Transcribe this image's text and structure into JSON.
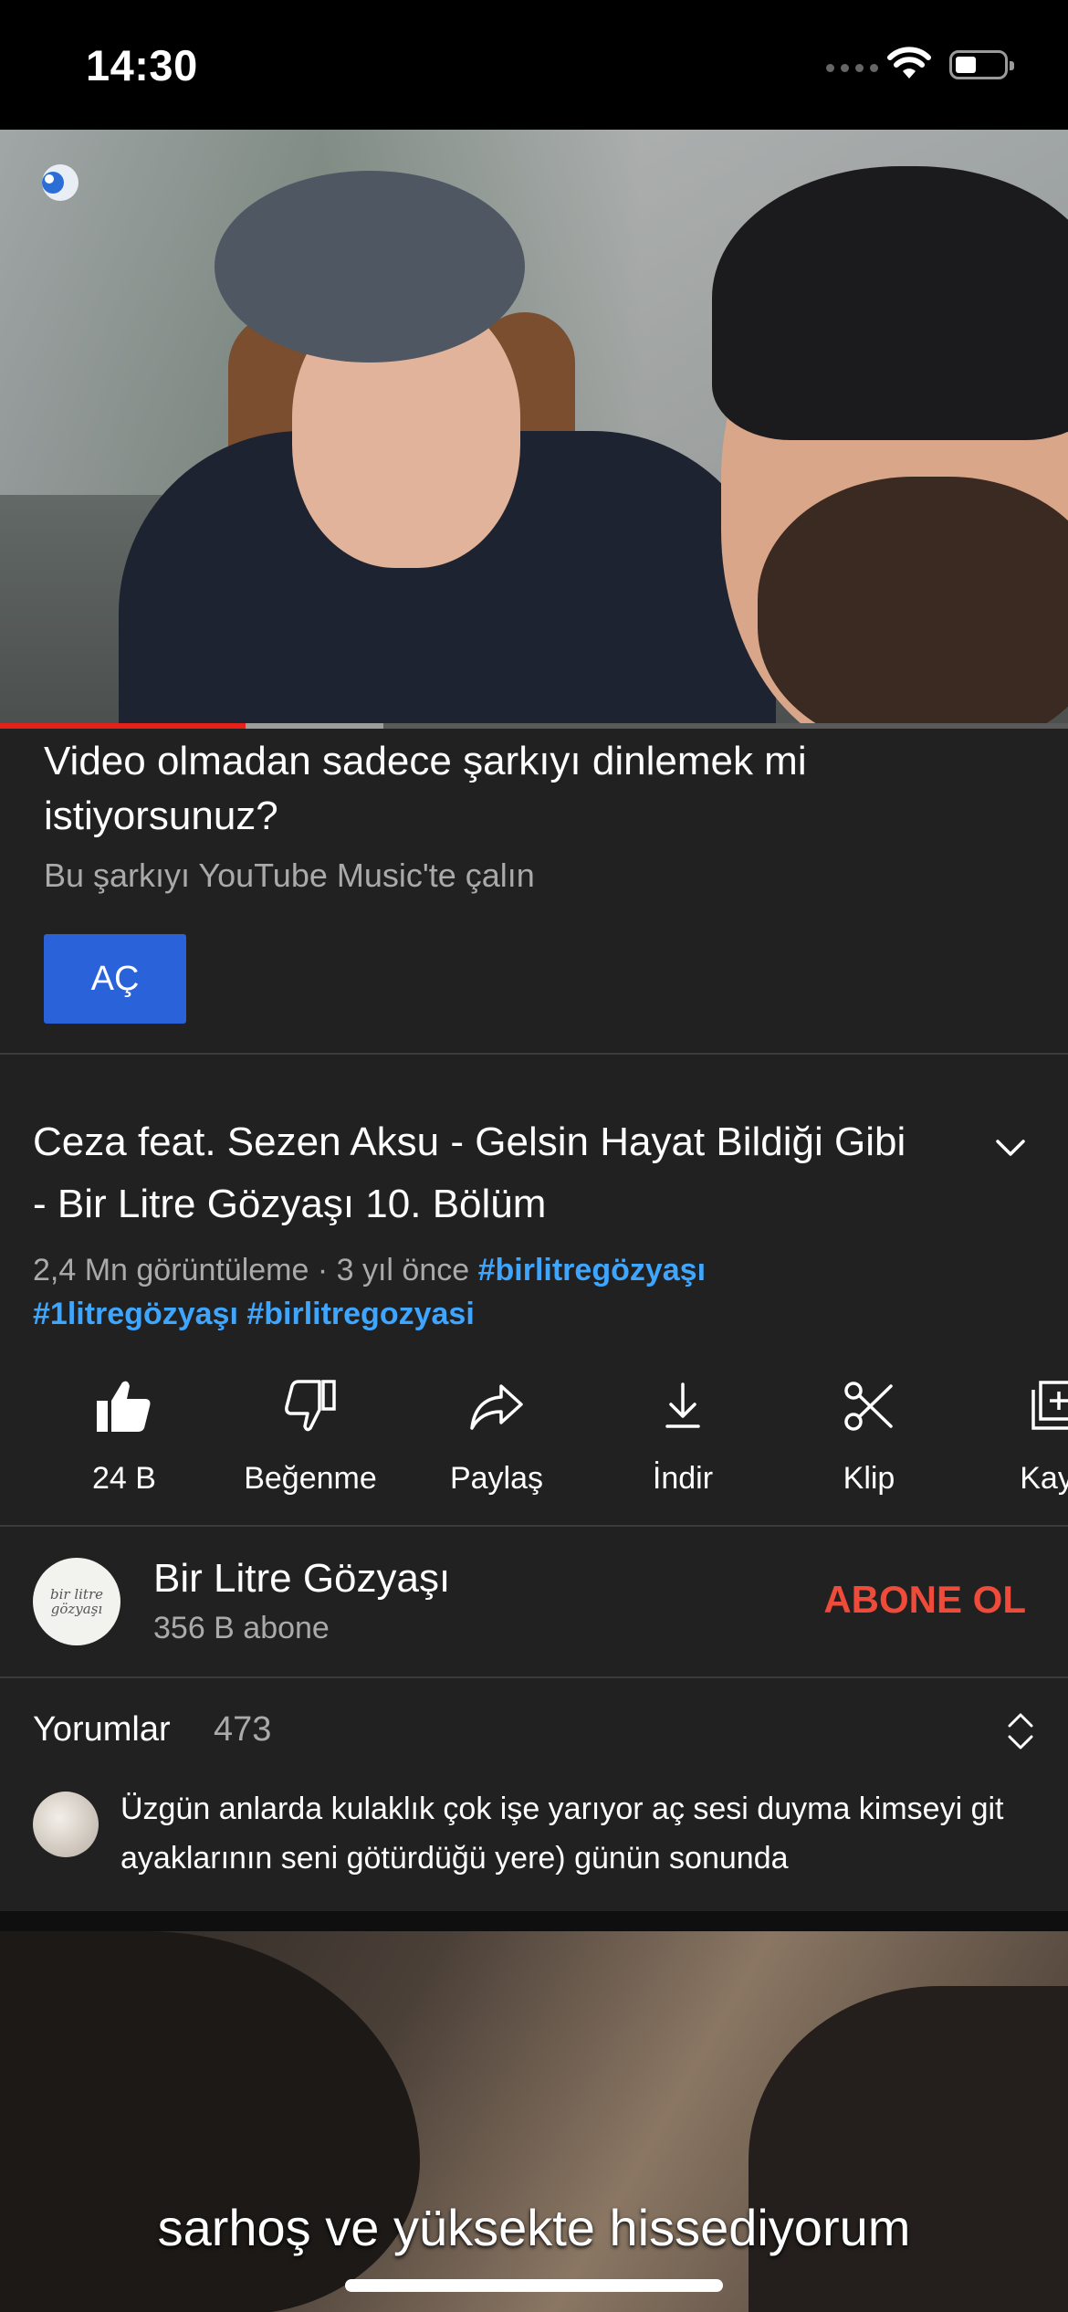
{
  "status_bar": {
    "time": "14:30"
  },
  "promo": {
    "title": "Video olmadan sadece şarkıyı dinlemek mi istiyorsunuz?",
    "subtitle": "Bu şarkıyı YouTube Music'te çalın",
    "button_label": "AÇ"
  },
  "video": {
    "title": "Ceza feat. Sezen Aksu - Gelsin Hayat Bildiği Gibi - Bir Litre Gözyaşı 10. Bölüm",
    "views": "2,4 Mn görüntüleme",
    "age": "3 yıl önce",
    "hashtags": [
      "#birlitregözyaşı",
      "#1litregözyaşı",
      "#birlitregozyasi"
    ],
    "progress_played_fraction": 0.23
  },
  "actions": [
    {
      "label": "24 B",
      "icon": "thumbs-up-icon"
    },
    {
      "label": "Beğenme",
      "icon": "thumbs-down-icon"
    },
    {
      "label": "Paylaş",
      "icon": "share-icon"
    },
    {
      "label": "İndir",
      "icon": "download-icon"
    },
    {
      "label": "Klip",
      "icon": "scissors-icon"
    },
    {
      "label": "Kayd",
      "icon": "save-to-playlist-icon"
    }
  ],
  "channel": {
    "name": "Bir Litre Gözyaşı",
    "subscribers": "356 B abone",
    "subscribe_label": "ABONE OL",
    "avatar_text": "bir litre gözyaşı"
  },
  "comments": {
    "label": "Yorumlar",
    "count": "473",
    "top_comment": "Üzgün anlarda kulaklık çok işe yarıyor aç sesi  duyma kimseyi git ayaklarının seni götürdüğü yere) günün sonunda"
  },
  "next_video": {
    "subtitle": "sarhoş ve yüksekte hissediyorum"
  },
  "colors": {
    "accent_blue": "#2962d9",
    "link_blue": "#3ea6ff",
    "subscribe_red": "#ee4b3b",
    "progress_red": "#e62117"
  }
}
